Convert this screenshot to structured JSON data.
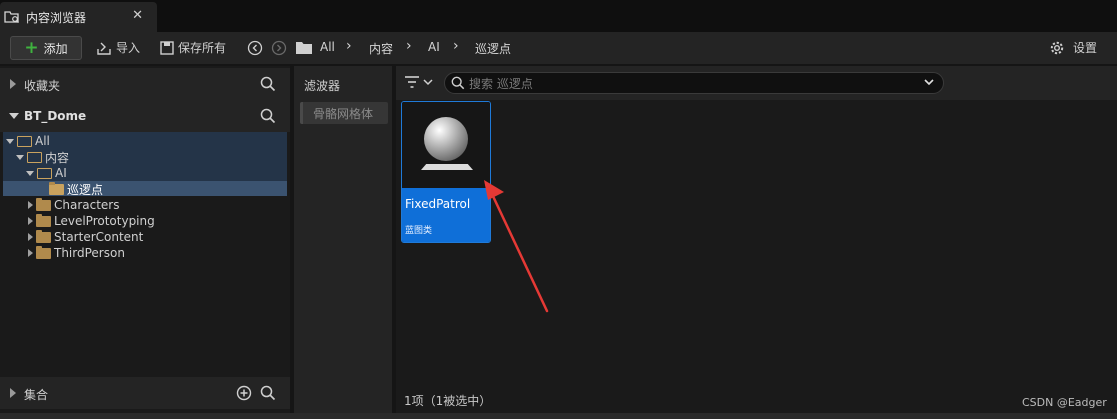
{
  "tab": {
    "title": "内容浏览器",
    "close": "✕"
  },
  "toolbar": {
    "add_label": "添加",
    "import_label": "导入",
    "save_all_label": "保存所有",
    "settings_label": "设置",
    "breadcrumb": [
      "All",
      "内容",
      "AI",
      "巡逻点"
    ]
  },
  "left": {
    "favorites_label": "收藏夹",
    "project_label": "BT_Dome",
    "collections_label": "集合",
    "tree": [
      {
        "label": "All",
        "state": "open"
      },
      {
        "label": "内容",
        "state": "open"
      },
      {
        "label": "AI",
        "state": "open"
      },
      {
        "label": "巡逻点",
        "state": "selected"
      },
      {
        "label": "Characters",
        "state": "closed"
      },
      {
        "label": "LevelPrototyping",
        "state": "closed"
      },
      {
        "label": "StarterContent",
        "state": "closed"
      },
      {
        "label": "ThirdPerson",
        "state": "closed"
      }
    ]
  },
  "filters": {
    "title": "滤波器",
    "chip": "骨骼网格体"
  },
  "main": {
    "search_placeholder": "搜索 巡逻点",
    "asset": {
      "name": "FixedPatrol",
      "type": "蓝图类"
    },
    "status": "1项（1被选中）"
  },
  "watermark": "CSDN @Eadger",
  "colors": {
    "accent": "#0f6fd8",
    "add_green": "#3fb23f",
    "folder": "#b08a4c",
    "arrow": "#e53935"
  }
}
